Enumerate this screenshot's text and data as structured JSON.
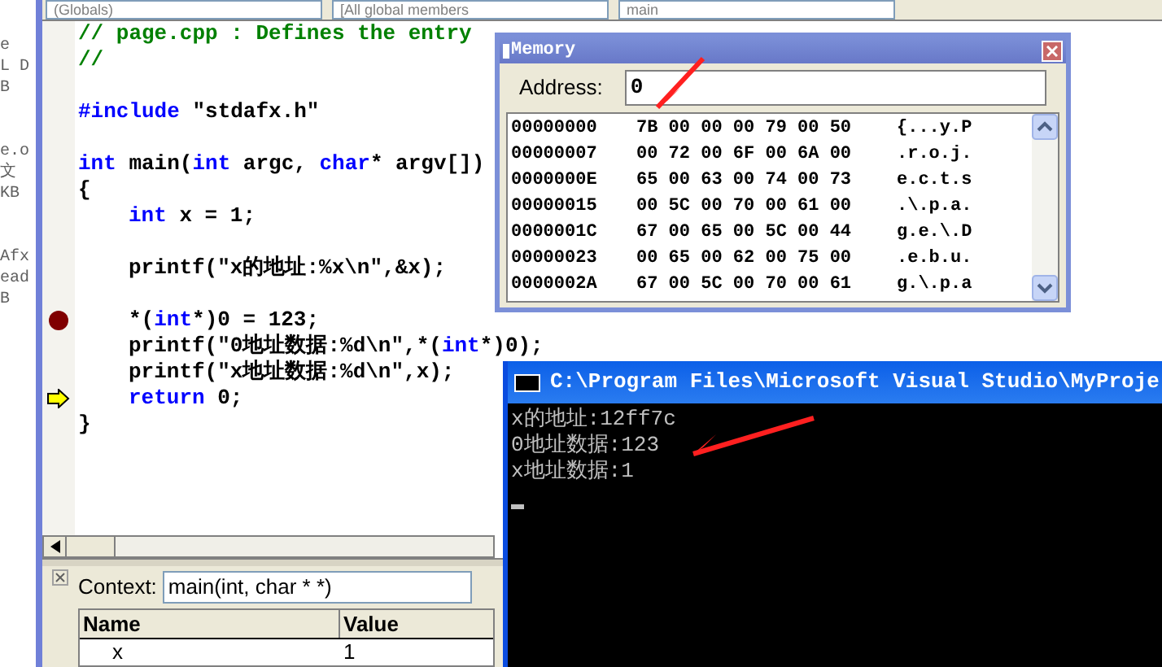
{
  "toolbar": {
    "combos": [
      "(Globals)",
      "[All global members",
      "main"
    ]
  },
  "file_view": {
    "items": [
      "e",
      "L D",
      "B",
      "e.o",
      "文",
      "KB",
      "Afx",
      "ead",
      "B"
    ]
  },
  "editor": {
    "lines": [
      {
        "breakpoint": false,
        "current": false,
        "tokens": [
          {
            "kind": "comment",
            "text": "// page.cpp : Defines the entry"
          }
        ]
      },
      {
        "breakpoint": false,
        "current": false,
        "tokens": [
          {
            "kind": "comment",
            "text": "//"
          }
        ]
      },
      {
        "breakpoint": false,
        "current": false
      },
      {
        "breakpoint": false,
        "current": false,
        "tokens": [
          {
            "kind": "keyword",
            "text": "#include"
          },
          {
            "kind": "plain",
            "text": " \"stdafx.h\""
          }
        ]
      },
      {
        "breakpoint": false,
        "current": false
      },
      {
        "breakpoint": false,
        "current": false,
        "tokens": [
          {
            "kind": "keyword",
            "text": "int"
          },
          {
            "kind": "plain",
            "text": " main("
          },
          {
            "kind": "keyword",
            "text": "int"
          },
          {
            "kind": "plain",
            "text": " argc, "
          },
          {
            "kind": "keyword",
            "text": "char"
          },
          {
            "kind": "plain",
            "text": "* argv[])"
          }
        ]
      },
      {
        "breakpoint": false,
        "current": false,
        "tokens": [
          {
            "kind": "plain",
            "text": "{"
          }
        ],
        "children": [
          {
            "breakpoint": false,
            "current": false,
            "tokens": [
              {
                "kind": "keyword",
                "text": "int"
              },
              {
                "kind": "plain",
                "text": " x = 1;"
              }
            ]
          },
          {
            "breakpoint": false,
            "current": false
          },
          {
            "breakpoint": false,
            "current": false,
            "tokens": [
              {
                "kind": "plain",
                "text": "printf(\"x的地址:%x\\n\",&x);"
              }
            ]
          },
          {
            "breakpoint": false,
            "current": false
          },
          {
            "breakpoint": true,
            "current": false,
            "tokens": [
              {
                "kind": "plain",
                "text": "*("
              },
              {
                "kind": "keyword",
                "text": "int"
              },
              {
                "kind": "plain",
                "text": "*)0 = 123;"
              }
            ]
          },
          {
            "breakpoint": false,
            "current": false,
            "tokens": [
              {
                "kind": "plain",
                "text": "printf(\"0地址数据:%d\\n\",*("
              },
              {
                "kind": "keyword",
                "text": "int"
              },
              {
                "kind": "plain",
                "text": "*)0);"
              }
            ]
          },
          {
            "breakpoint": false,
            "current": false,
            "tokens": [
              {
                "kind": "plain",
                "text": "printf(\"x地址数据:%d\\n\",x);"
              }
            ]
          },
          {
            "breakpoint": false,
            "current": true,
            "tokens": [
              {
                "kind": "keyword",
                "text": "return"
              },
              {
                "kind": "plain",
                "text": " 0;"
              }
            ]
          }
        ]
      },
      {
        "breakpoint": false,
        "current": false,
        "tokens": [
          {
            "kind": "plain",
            "text": "}"
          }
        ]
      }
    ]
  },
  "memory_window": {
    "title": "Memory",
    "address_label": "Address:",
    "address_value": "0",
    "rows": [
      {
        "address": "00000000",
        "bytes": "7B 00 00 00 79 00 50",
        "ascii": "{...y.P"
      },
      {
        "address": "00000007",
        "bytes": "00 72 00 6F 00 6A 00",
        "ascii": ".r.o.j."
      },
      {
        "address": "0000000E",
        "bytes": "65 00 63 00 74 00 73",
        "ascii": "e.c.t.s"
      },
      {
        "address": "00000015",
        "bytes": "00 5C 00 70 00 61 00",
        "ascii": ".\\.p.a."
      },
      {
        "address": "0000001C",
        "bytes": "67 00 65 00 5C 00 44",
        "ascii": "g.e.\\.D"
      },
      {
        "address": "00000023",
        "bytes": "00 65 00 62 00 75 00",
        "ascii": ".e.b.u."
      },
      {
        "address": "0000002A",
        "bytes": "67 00 5C 00 70 00 61",
        "ascii": "g.\\.p.a"
      }
    ]
  },
  "console_window": {
    "title": "C:\\Program Files\\Microsoft Visual Studio\\MyProje",
    "lines": [
      "x的地址:12ff7c",
      "0地址数据:123",
      "x地址数据:1"
    ]
  },
  "variables_panel": {
    "context_label": "Context:",
    "context_value": "main(int, char * *)",
    "columns": [
      "Name",
      "Value"
    ],
    "rows": [
      {
        "name": "x",
        "value": "1"
      }
    ]
  }
}
